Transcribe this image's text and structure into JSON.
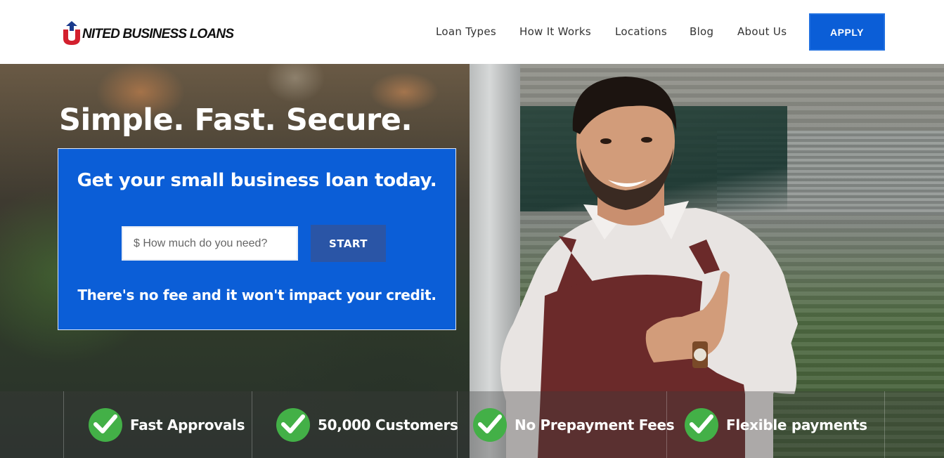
{
  "header": {
    "logo_text": "NITED BUSINESS LOANS",
    "logo_letter": "U",
    "nav": [
      {
        "label": "Loan Types"
      },
      {
        "label": "How It Works"
      },
      {
        "label": "Locations"
      },
      {
        "label": "Blog"
      },
      {
        "label": "About Us"
      }
    ],
    "apply_label": "APPLY"
  },
  "hero": {
    "title": "Simple. Fast. Secure.",
    "form": {
      "heading": "Get your small business loan today.",
      "amount_placeholder": "$ How much do you need?",
      "amount_value": "",
      "start_label": "START",
      "note": "There's no fee and it won't impact your credit."
    }
  },
  "features": [
    {
      "label": "Fast Approvals",
      "icon": "check-circle-icon"
    },
    {
      "label": "50,000 Customers",
      "icon": "check-circle-icon"
    },
    {
      "label": "No Prepayment Fees",
      "icon": "check-circle-icon"
    },
    {
      "label": "Flexible payments",
      "icon": "check-circle-icon"
    }
  ],
  "colors": {
    "brand_blue": "#0b5ed7",
    "start_button": "#2a55a6",
    "check_green": "#43b047",
    "logo_red": "#d3202e"
  }
}
